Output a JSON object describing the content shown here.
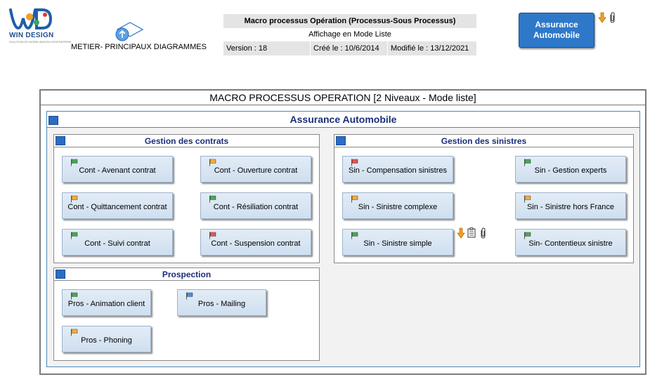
{
  "header": {
    "logo_text": "WIN DESIGN",
    "logo_sub": "SOLUTION DE MODÉLISATION D'ENTREPRISE",
    "metier_label": "METIER- PRINCIPAUX DIAGRAMMES",
    "info": {
      "title": "Macro processus Opération (Processus-Sous Processus)",
      "mode": "Affichage en Mode Liste",
      "version": "Version : 18",
      "created": "Créé le : 10/6/2014",
      "modified": "Modifié le : 13/12/2021"
    },
    "assurance_button": "Assurance Automobile"
  },
  "frame_title": "MACRO PROCESSUS OPERATION [2 Niveaux - Mode liste]",
  "panel_title": "Assurance Automobile",
  "groups": {
    "contrats": {
      "title": "Gestion des contrats",
      "items": [
        {
          "label": "Cont - Avenant contrat",
          "flag": "green"
        },
        {
          "label": "Cont - Ouverture contrat",
          "flag": "orange"
        },
        {
          "label": "Cont - Quittancement contrat",
          "flag": "orange"
        },
        {
          "label": "Cont - Résiliation contrat",
          "flag": "green"
        },
        {
          "label": "Cont - Suivi contrat",
          "flag": "green"
        },
        {
          "label": "Cont - Suspension contrat",
          "flag": "red"
        }
      ]
    },
    "sinistres": {
      "title": "Gestion des sinistres",
      "items": [
        {
          "label": "Sin - Compensation sinistres",
          "flag": "red"
        },
        {
          "label": "Sin - Gestion experts",
          "flag": "green"
        },
        {
          "label": "Sin - Sinistre complexe",
          "flag": "orange"
        },
        {
          "label": "Sin - Sinistre hors France",
          "flag": "orange"
        },
        {
          "label": "Sin - Sinistre simple",
          "flag": "green"
        },
        {
          "label": "Sin- Contentieux sinistre",
          "flag": "green"
        }
      ]
    },
    "prospection": {
      "title": "Prospection",
      "items": [
        {
          "label": "Pros - Animation client",
          "flag": "green"
        },
        {
          "label": "Pros - Mailing",
          "flag": "blue"
        },
        {
          "label": "Pros - Phoning",
          "flag": "orange"
        }
      ]
    }
  },
  "colors": {
    "flag_green": "#2e9b3a",
    "flag_orange": "#f0a020",
    "flag_red": "#e03a3a",
    "flag_blue": "#2f7fd0",
    "title_blue": "#1a2e7a",
    "accent": "#2e78c9"
  }
}
